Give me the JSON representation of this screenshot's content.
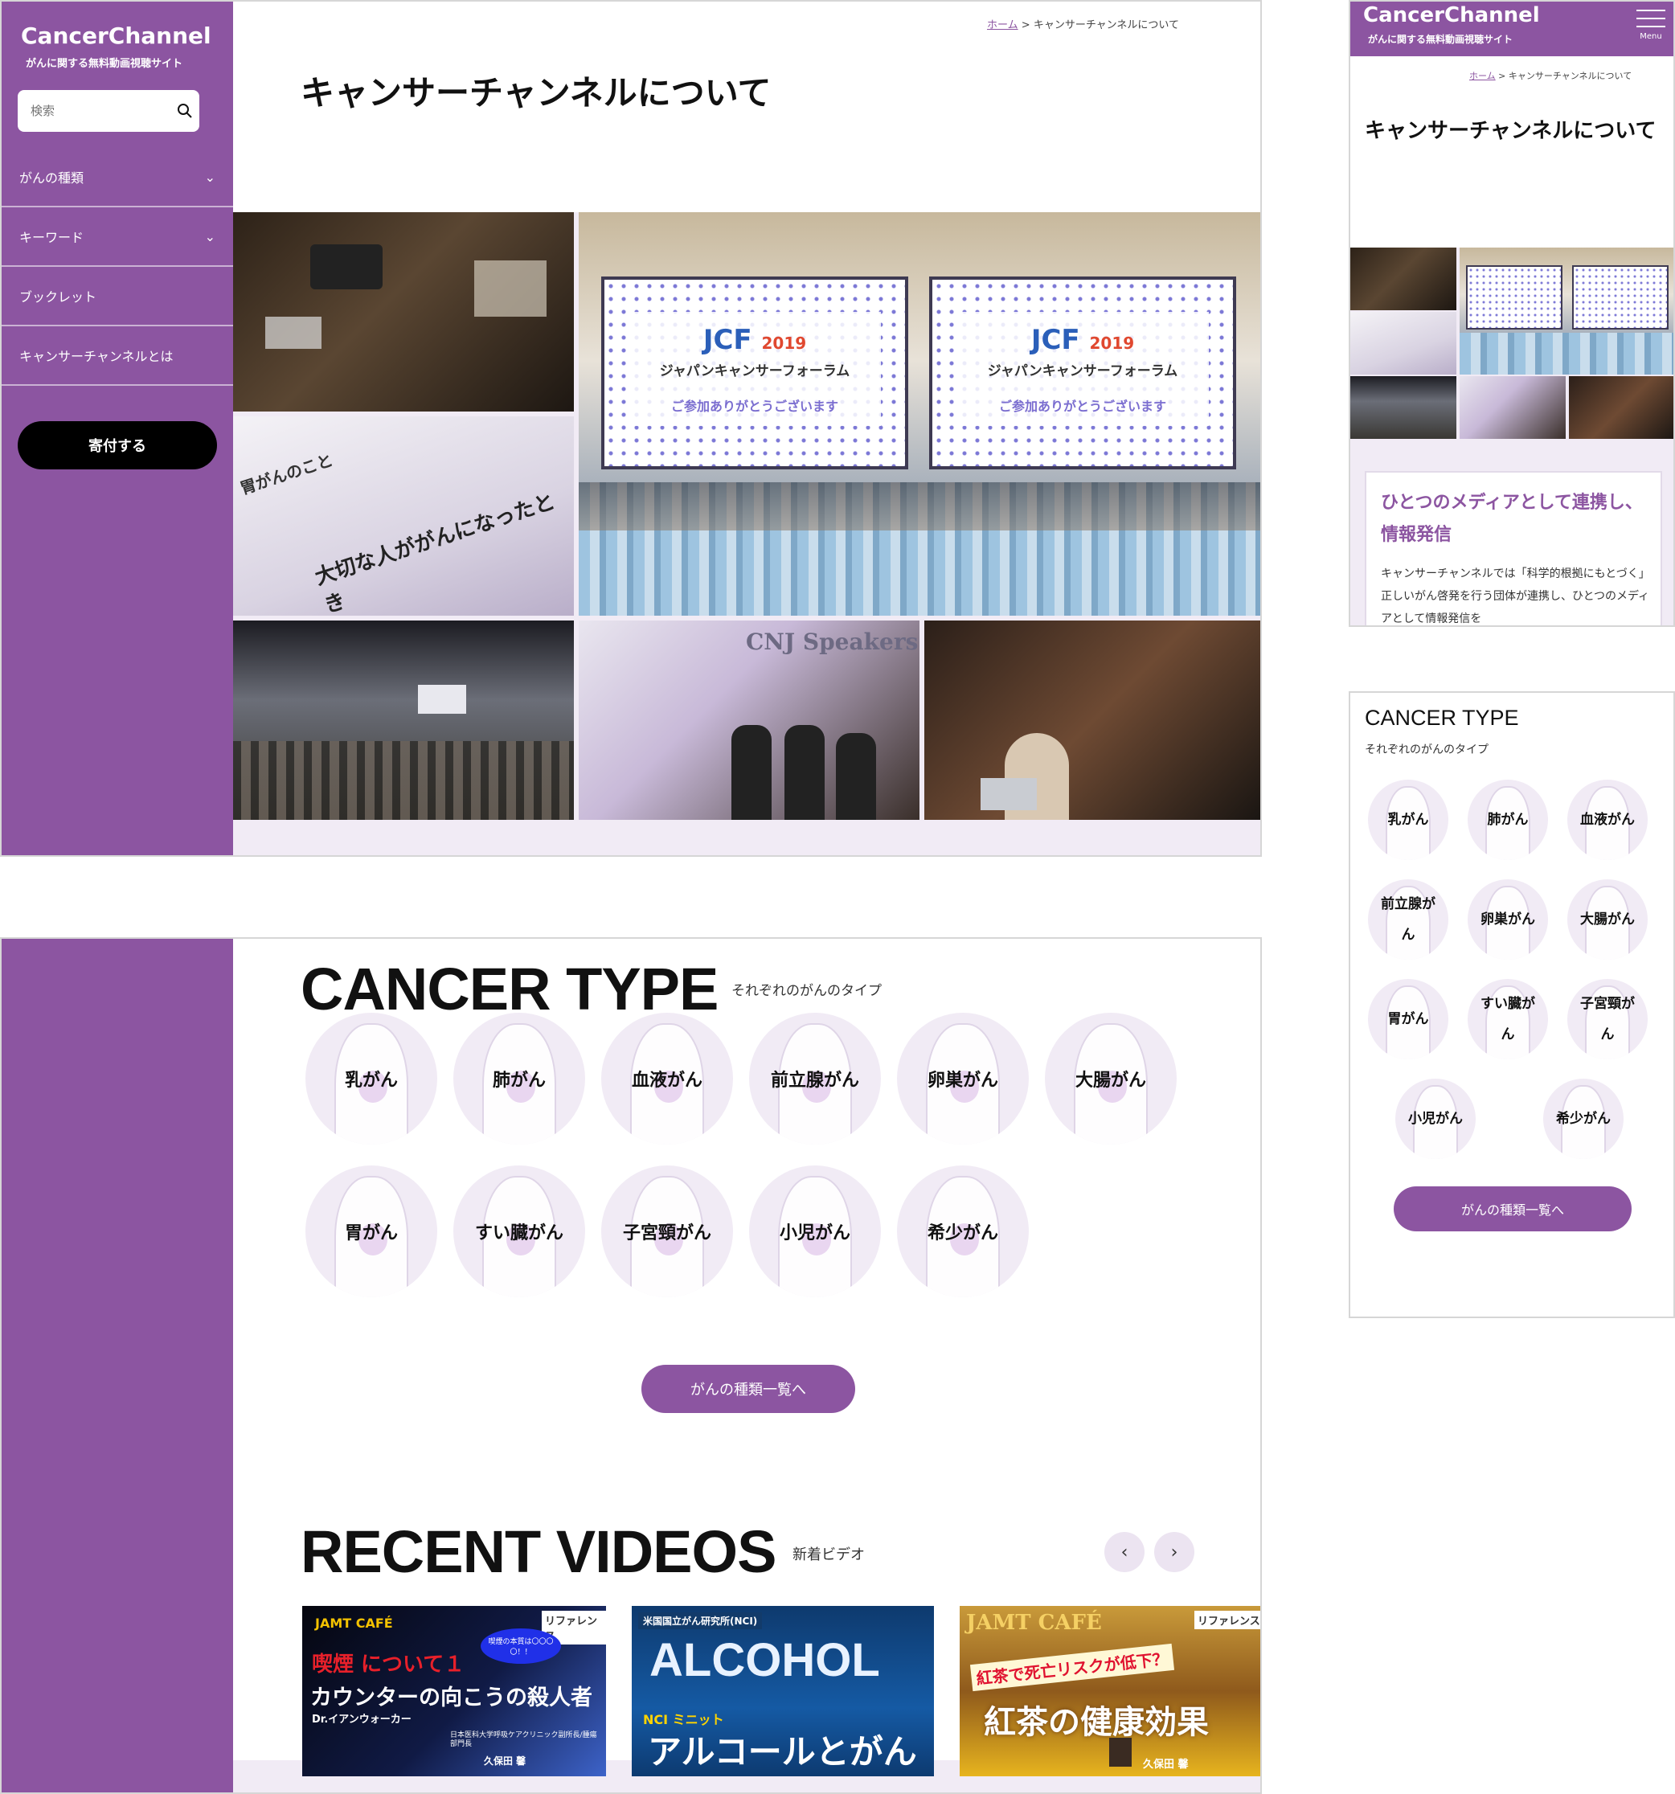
{
  "site": {
    "name": "CancerChannel",
    "tagline": "がんに関する無料動画視聴サイト",
    "brand_color": "#8c55a1"
  },
  "search": {
    "placeholder": "検索",
    "icon": "search-icon"
  },
  "nav": {
    "items": [
      {
        "label": "がんの種類",
        "has_dropdown": true
      },
      {
        "label": "キーワード",
        "has_dropdown": true
      },
      {
        "label": "ブックレット",
        "has_dropdown": false
      },
      {
        "label": "キャンサーチャンネルとは",
        "has_dropdown": false
      }
    ],
    "donate_label": "寄付する"
  },
  "breadcrumb": {
    "home": "ホーム",
    "separator": ">",
    "current": "キャンサーチャンネルについて"
  },
  "page_title": "キャンサーチャンネルについて",
  "collage": {
    "banner_year": "2019",
    "banner_title": "ジャパンキャンサーフォーラム",
    "banner_thanks": "ご参加ありがとうございます",
    "booklet_text": "大切な人ががんになったとき",
    "booklet_side": "胃がんのこと",
    "speakers_text": "CNJ Speakers"
  },
  "cancer_type": {
    "title": "CANCER TYPE",
    "subtitle": "それぞれのがんのタイプ",
    "types": [
      "乳がん",
      "肺がん",
      "血液がん",
      "前立腺がん",
      "卵巣がん",
      "大腸がん",
      "胃がん",
      "すい臓がん",
      "子宮頸がん",
      "小児がん",
      "希少がん"
    ],
    "types_mobile": [
      "乳がん",
      "肺がん",
      "血液がん",
      "前立腺がん",
      "卵巣がん",
      "大腸がん",
      "胃がん",
      "すい臓がん",
      "子宮頸がん",
      "小児がん",
      "希少がん"
    ],
    "more_label": "がんの種類一覧へ"
  },
  "recent": {
    "title": "RECENT VIDEOS",
    "subtitle": "新着ビデオ",
    "prev": "‹",
    "next": "›",
    "videos": [
      {
        "badge": "JAMT CAFÉ",
        "ref": "リファレンス",
        "line1": "喫煙 について１",
        "line2": "カウンターの向こうの殺人者",
        "bubble": "喫煙の本質は〇〇〇〇！！",
        "speaker": "Dr.イアンウォーカー",
        "affil": "日本医科大学呼吸ケアクリニック副所長/腫瘍部門長",
        "name": "久保田 馨"
      },
      {
        "badge": "米国国立がん研究所(NCI)",
        "line1": "ALCOHOL",
        "series": "NCI ミニット",
        "line2": "アルコールとがん"
      },
      {
        "badge": "JAMT CAFÉ",
        "ref": "リファレンス",
        "line1": "紅茶で死亡リスクが低下？",
        "line2": "紅茶の健康効果",
        "name": "久保田 馨"
      }
    ]
  },
  "mobile": {
    "menu_label": "Menu",
    "intro_heading": "ひとつのメディアとして連携し、情報発信",
    "intro_body": "キャンサーチャンネルでは「科学的根拠にもとづく」正しいがん啓発を行う団体が連携し、ひとつのメディアとして情報発信を"
  }
}
